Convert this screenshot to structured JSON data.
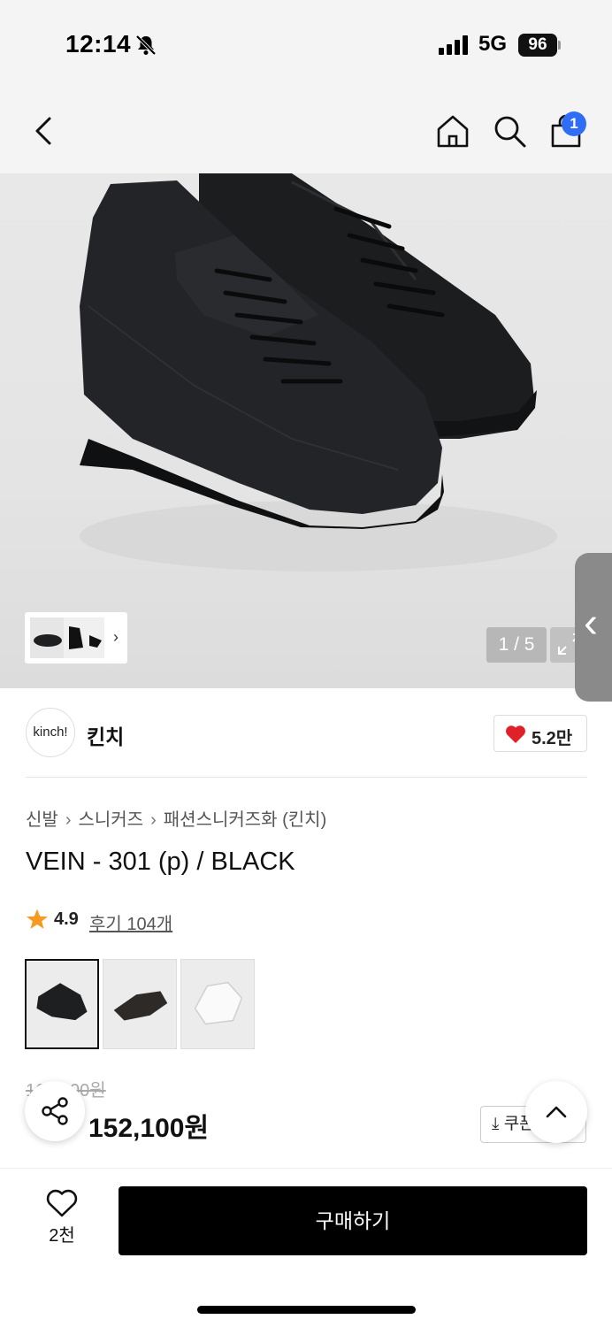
{
  "status_bar": {
    "time": "12:14",
    "network": "5G",
    "battery": "96"
  },
  "nav": {
    "cart_count": "1"
  },
  "gallery": {
    "counter": "1 / 5"
  },
  "brand": {
    "logo_text": "kinch!",
    "name": "킨치",
    "likes": "5.2만"
  },
  "breadcrumb": [
    "신발",
    "스니커즈",
    "패션스니커즈화 (킨치)"
  ],
  "product": {
    "title": "VEIN - 301 (p) / BLACK",
    "rating": "4.9",
    "reviews_label": "후기 104개",
    "original_price": "169,000원",
    "sale_price": "152,100원"
  },
  "color_options": [
    {
      "name": "black",
      "color": "#1e1f21",
      "selected": true
    },
    {
      "name": "dark-brown",
      "color": "#2e2a27",
      "selected": false
    },
    {
      "name": "white",
      "color": "#f2f2f2",
      "selected": false
    }
  ],
  "coupon": {
    "label": "쿠폰받기"
  },
  "bottom_bar": {
    "wish_count": "2천",
    "buy_label": "구매하기"
  },
  "colors": {
    "accent_blue": "#2f6df6",
    "heart_red": "#e0212a",
    "star_orange": "#f59a23"
  }
}
